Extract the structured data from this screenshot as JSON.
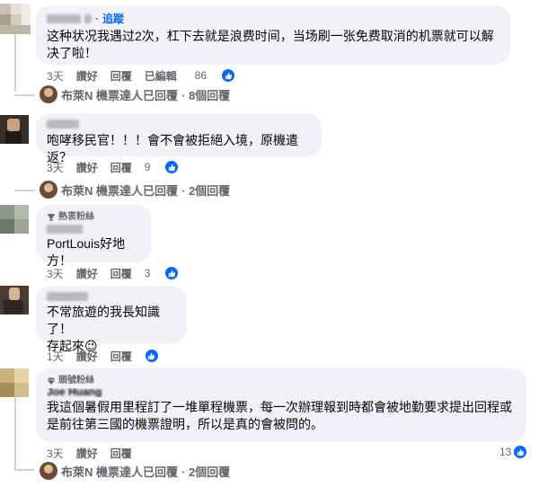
{
  "comments": [
    {
      "follow_label": "追蹤",
      "dot": "·",
      "text": "这种状况我遇过2次，杠下去就是浪费时间，当场刷一张免费取消的机票就可以解决了啦！",
      "time": "3天",
      "like": "讚好",
      "reply": "回覆",
      "edited": "已編輯",
      "reactions": "86"
    },
    {
      "text": "咆哮移民官！！！會不會被拒絕入境，原機遣返？",
      "time": "3天",
      "like": "讚好",
      "reply": "回覆",
      "reactions": "9"
    },
    {
      "badge": "熱衷粉絲",
      "text": "PortLouis好地方！",
      "time": "3天",
      "like": "讚好",
      "reply": "回覆",
      "reactions": "3"
    },
    {
      "text_line1": "不常旅遊的我長知識了！",
      "text_line2": "存起來😉",
      "time": "1天",
      "like": "讚好",
      "reply": "回覆"
    },
    {
      "badge": "頭號粉絲",
      "name_partial": "Joe Huang",
      "text": "我這個暑假用里程訂了一堆單程機票，每一次辦理報到時都會被地勤要求提出回程或是前往第三國的機票證明，所以是真的會被問的。",
      "time": "3天",
      "like": "讚好",
      "reply": "回覆",
      "reactions": "13"
    }
  ],
  "reply_summaries": [
    {
      "replier": "布萊N 機票達人已回覆",
      "count": "· 8個回覆"
    },
    {
      "replier": "布萊N 機票達人已回覆",
      "count": "· 2個回覆"
    },
    {
      "replier": "布萊N 機票達人已回覆",
      "count": "· 2個回覆"
    }
  ],
  "colors": {
    "link_blue": "#0866ff",
    "bubble_bg": "#f0f2f5",
    "meta_gray": "#65676b"
  }
}
